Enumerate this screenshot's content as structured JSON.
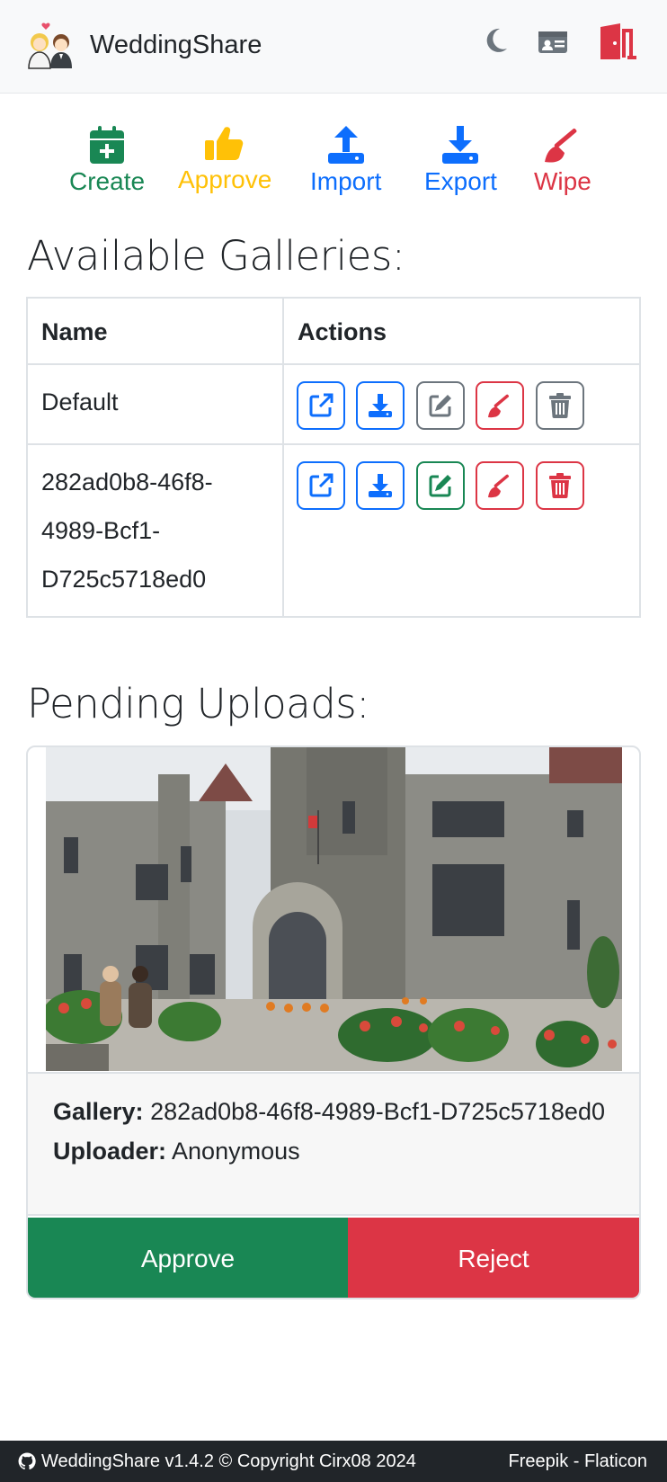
{
  "navbar": {
    "brand": "WeddingShare",
    "icons": [
      "brand-logo-icon",
      "moon-icon",
      "id-card-icon",
      "door-open-icon"
    ]
  },
  "toolbar": {
    "create": "Create",
    "approve": "Approve",
    "import": "Import",
    "export": "Export",
    "wipe": "Wipe"
  },
  "galleries": {
    "heading": "Available Galleries:",
    "columns": {
      "name": "Name",
      "actions": "Actions"
    },
    "rows": [
      {
        "name": "Default"
      },
      {
        "name": "282ad0b8-46f8-4989-Bcf1-D725c5718ed0"
      }
    ]
  },
  "pending": {
    "heading": "Pending Uploads:",
    "gallery_label": "Gallery:",
    "gallery_value": "282ad0b8-46f8-4989-Bcf1-D725c5718ed0",
    "uploader_label": "Uploader:",
    "uploader_value": "Anonymous",
    "approve": "Approve",
    "reject": "Reject"
  },
  "footer": {
    "left": "WeddingShare v1.4.2 © Copyright Cirx08 2024",
    "right": "Freepik - Flaticon"
  },
  "colors": {
    "success": "#198754",
    "warning": "#ffc107",
    "primary": "#0d6efd",
    "danger": "#dc3545",
    "secondary": "#6c757d"
  }
}
